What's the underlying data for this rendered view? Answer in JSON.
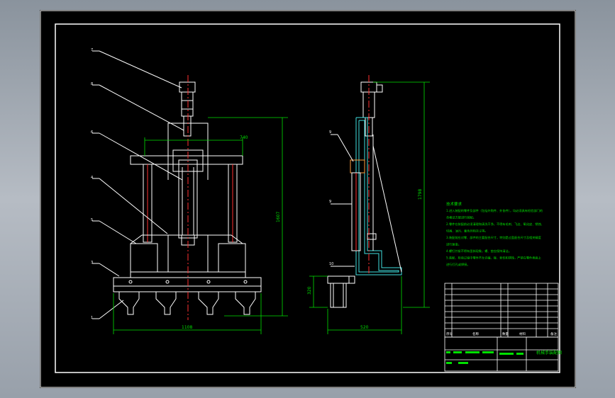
{
  "drawing": {
    "front_view": {
      "part_callouts": [
        "7",
        "8",
        "6",
        "4",
        "5",
        "3",
        "1"
      ],
      "dim_width": "1108",
      "dim_height": "1607",
      "dim_top": "740"
    },
    "side_view": {
      "part_callouts": [
        "9",
        "9",
        "10"
      ],
      "dim_width": "520",
      "dim_height": "1798",
      "dim_base": "320"
    },
    "tech_requirements": {
      "title": "技术要求",
      "lines": [
        "1.进入装配的零件及部件（包括外购件、外协件），均必须具有检验部门的",
        "合格证方能进行装配。",
        "2.零件在装配前必须清理和清洗干净，不得有毛刺、飞边、氧化皮、锈蚀、",
        "切屑、油污、着色剂和灰尘等。",
        "3.装配前应对零、部件的主要配合尺寸，特别是过盈配合尺寸及相关精度",
        "进行复查。",
        "4.螺钉拧紧不得有歪斜现象，螺、垫应保持清洁。",
        "5.装配、检验过程中零件不允许磕、碰、划伤和锈蚀，严禁在零件表面上",
        "进行打孔或焊接。"
      ]
    },
    "bom_header": [
      "序号",
      "名称",
      "数量",
      "材料",
      "备注"
    ],
    "title_block": {
      "drawing_name": "机械手装配图"
    }
  }
}
